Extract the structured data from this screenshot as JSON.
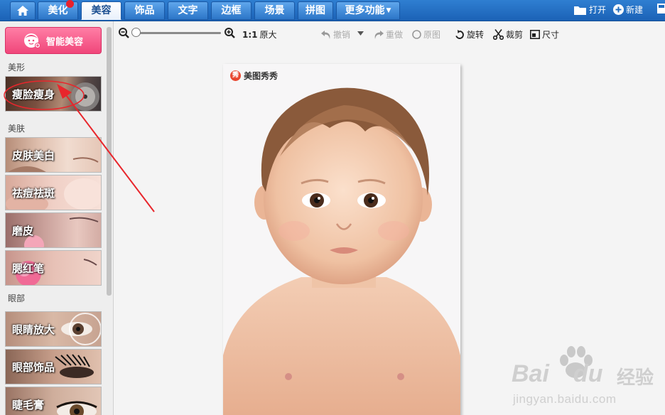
{
  "tabs": [
    {
      "label": ""
    },
    {
      "label": "美化"
    },
    {
      "label": "美容"
    },
    {
      "label": "饰品"
    },
    {
      "label": "文字"
    },
    {
      "label": "边框"
    },
    {
      "label": "场景"
    },
    {
      "label": "拼图"
    },
    {
      "label": "更多功能"
    }
  ],
  "active_tab": "美容",
  "top_actions": {
    "open": "打开",
    "new": "新建"
  },
  "sidebar": {
    "smart_button": "智能美容",
    "sections": [
      {
        "title": "美形",
        "items": [
          "瘦脸瘦身"
        ]
      },
      {
        "title": "美肤",
        "items": [
          "皮肤美白",
          "祛痘祛斑",
          "磨皮",
          "腮红笔"
        ]
      },
      {
        "title": "眼部",
        "items": [
          "眼睛放大",
          "眼部饰品",
          "睫毛膏"
        ]
      }
    ]
  },
  "toolbar": {
    "zoom_ratio": "1:1",
    "original_size": "原大",
    "undo": "撤销",
    "redo": "重做",
    "original": "原图",
    "rotate": "旋转",
    "crop": "裁剪",
    "resize": "尺寸"
  },
  "canvas": {
    "watermark": "美图秀秀",
    "watermark_logo": "秀"
  },
  "site_watermark": {
    "brand": "Bai",
    "brand2": "du",
    "cn": "经验",
    "url": "jingyan.baidu.com"
  },
  "colors": {
    "topbar": "#1f6cbf",
    "smart_button": "#f0467a",
    "annotation": "#e8262c"
  }
}
